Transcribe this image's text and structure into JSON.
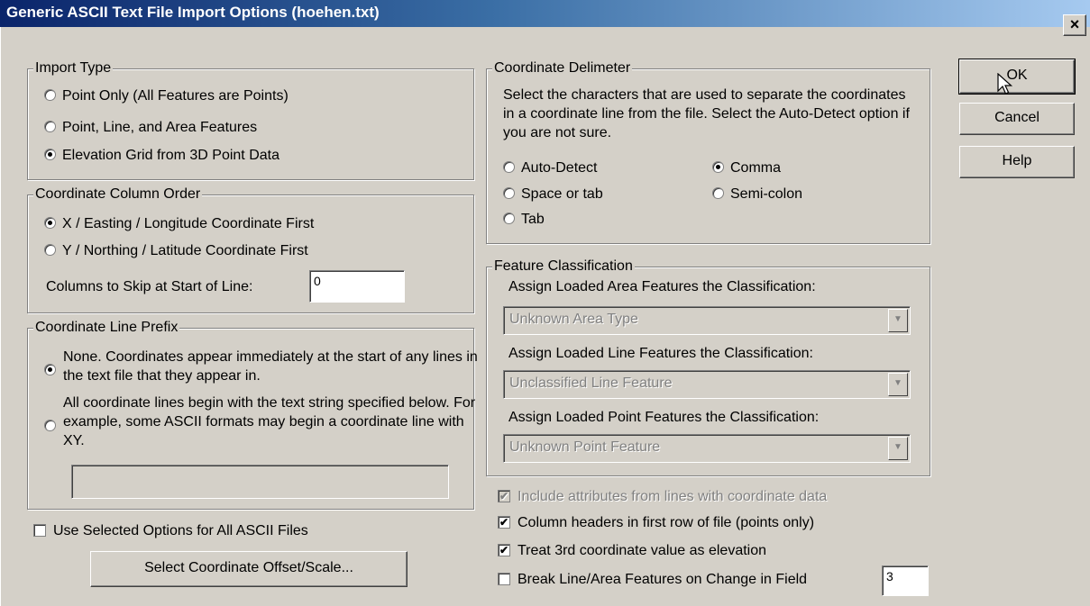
{
  "dialog": {
    "title": "Generic ASCII Text File Import Options (hoehen.txt)",
    "close_icon": "×",
    "close_icon_name": "close-icon"
  },
  "import_type": {
    "legend": "Import Type",
    "options": [
      {
        "label": "Point Only (All Features are Points)",
        "selected": false
      },
      {
        "label": "Point, Line, and Area Features",
        "selected": false
      },
      {
        "label": "Elevation Grid from 3D Point Data",
        "selected": true
      }
    ]
  },
  "column_order": {
    "legend": "Coordinate Column Order",
    "options": [
      {
        "label": "X / Easting / Longitude Coordinate First",
        "selected": true
      },
      {
        "label": "Y / Northing / Latitude Coordinate First",
        "selected": false
      }
    ],
    "skip_label": "Columns to Skip at Start of Line:",
    "skip_value": "0"
  },
  "line_prefix": {
    "legend": "Coordinate Line Prefix",
    "option_none_label": "None. Coordinates appear immediately at the start of any lines in the text file that they appear in.",
    "option_prefix_label": "All coordinate lines begin with the text string specified below. For example, some ASCII formats may begin a coordinate line with XY.",
    "selected": "none",
    "prefix_value": ""
  },
  "use_selected_all": {
    "label": "Use Selected Options for All ASCII Files",
    "checked": false
  },
  "offset_button_label": "Select Coordinate Offset/Scale...",
  "delimiter": {
    "legend": "Coordinate Delimeter",
    "description": "Select the characters that are used to separate the coordinates in a coordinate line from the file. Select the Auto-Detect option if you are not sure.",
    "options": {
      "auto_detect": "Auto-Detect",
      "comma": "Comma",
      "space_or_tab": "Space or tab",
      "semicolon": "Semi-colon",
      "tab": "Tab"
    },
    "selected": "comma"
  },
  "classification": {
    "legend": "Feature Classification",
    "area_label": "Assign Loaded Area Features the Classification:",
    "area_value": "Unknown Area Type",
    "line_label": "Assign Loaded Line Features the Classification:",
    "line_value": "Unclassified Line Feature",
    "point_label": "Assign Loaded Point Features the Classification:",
    "point_value": "Unknown Point Feature",
    "dropdown_icon": "▼"
  },
  "checkboxes": {
    "include_attributes": {
      "label": "Include attributes from lines with coordinate data",
      "checked": true,
      "enabled": false
    },
    "column_headers": {
      "label": "Column headers in first row of file (points only)",
      "checked": true
    },
    "treat_elevation": {
      "label": "Treat 3rd coordinate value as elevation",
      "checked": true
    },
    "break_features": {
      "label": "Break Line/Area Features on Change in Field",
      "checked": false,
      "field_value": "3"
    }
  },
  "buttons": {
    "ok": "OK",
    "cancel": "Cancel",
    "help": "Help"
  },
  "check_mark": "✔"
}
